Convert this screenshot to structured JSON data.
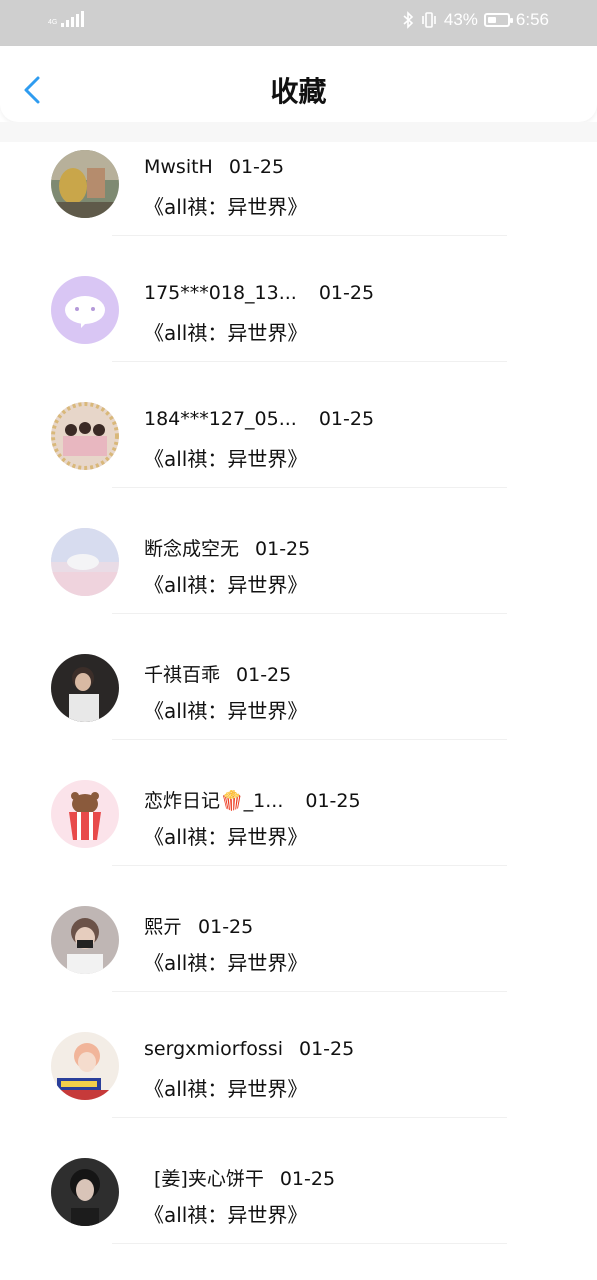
{
  "status_bar": {
    "network": "4G",
    "battery_percent": "43%",
    "time": "6:56",
    "battery_level": 0.43,
    "icons": [
      "signal-icon",
      "bluetooth-icon",
      "vibrate-icon",
      "battery-icon"
    ]
  },
  "header": {
    "title": "收藏",
    "back_icon": "chevron-left-icon",
    "accent_color": "#2f9cf0"
  },
  "items": [
    {
      "username": "MwsitH",
      "date": "01-25",
      "subtitle": "《all祺：异世界》"
    },
    {
      "username": "175***018_13...",
      "date": "01-25",
      "subtitle": "《all祺：异世界》"
    },
    {
      "username": "184***127_05...",
      "date": "01-25",
      "subtitle": "《all祺：异世界》"
    },
    {
      "username": "断念成空无",
      "date": "01-25",
      "subtitle": "《all祺：异世界》"
    },
    {
      "username": "千祺百乖",
      "date": "01-25",
      "subtitle": "《all祺：异世界》"
    },
    {
      "username": "恋炸日记🍿_1...",
      "date": "01-25",
      "subtitle": "《all祺：异世界》"
    },
    {
      "username": "熙亓",
      "date": "01-25",
      "subtitle": "《all祺：异世界》"
    },
    {
      "username": "sergxmiorfossi",
      "date": "01-25",
      "subtitle": "《all祺：异世界》"
    },
    {
      "username": "[姜]夹心饼干",
      "date": "01-25",
      "subtitle": "《all祺：异世界》"
    }
  ]
}
